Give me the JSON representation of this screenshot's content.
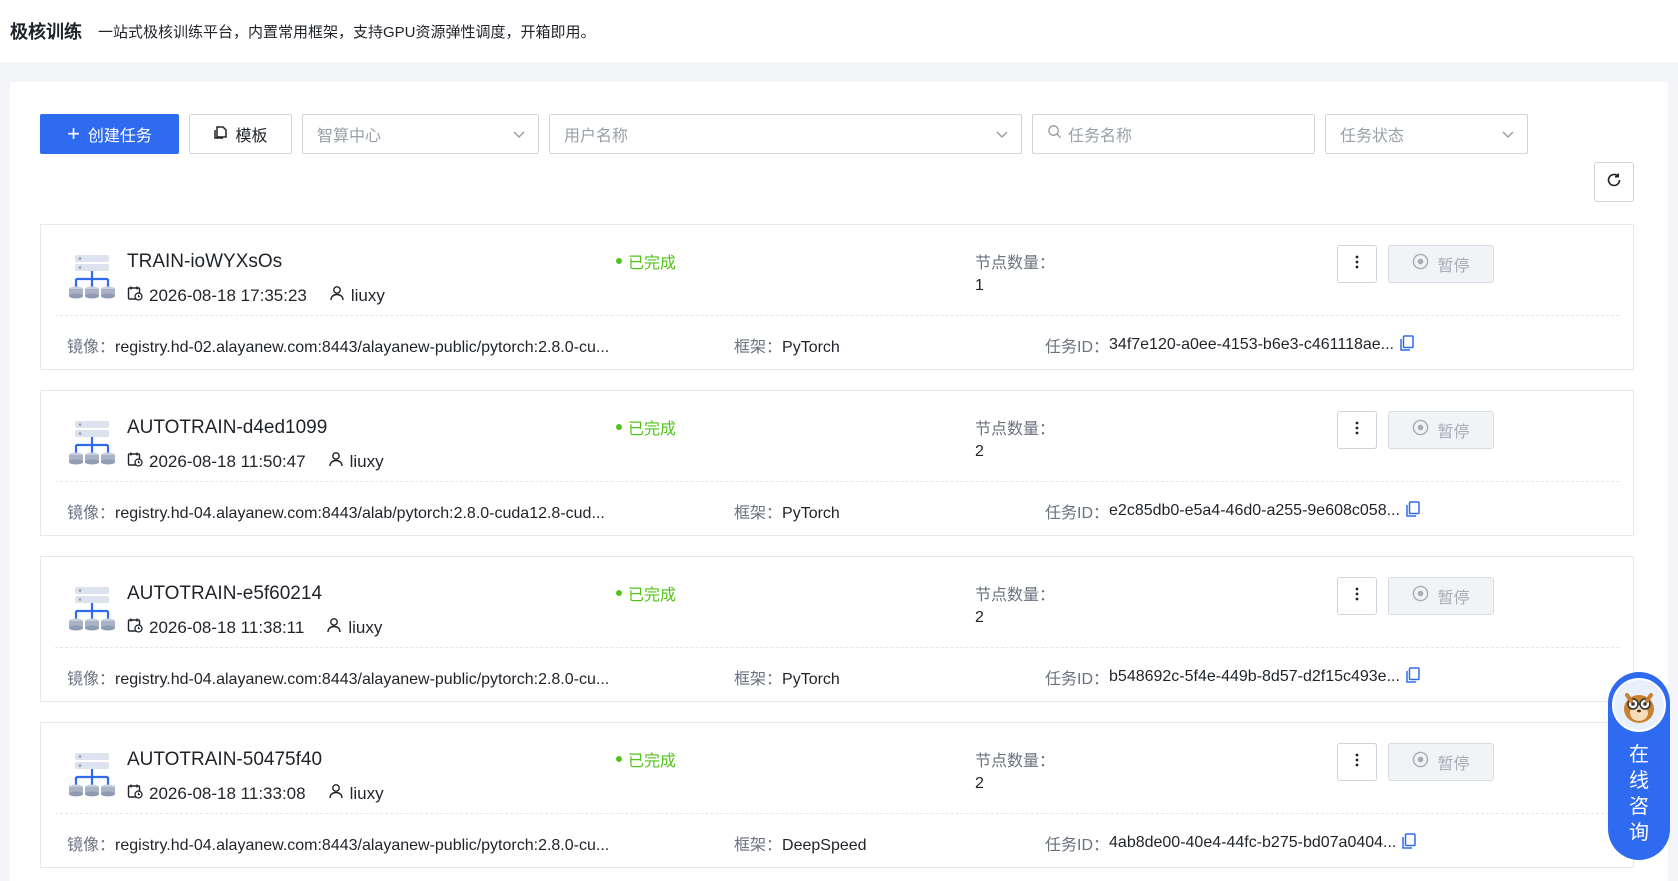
{
  "header": {
    "title": "极核训练",
    "description": "一站式极核训练平台，内置常用框架，支持GPU资源弹性调度，开箱即用。"
  },
  "toolbar": {
    "create_label": "创建任务",
    "template_label": "模板",
    "compute_center_placeholder": "智算中心",
    "username_placeholder": "用户名称",
    "taskname_placeholder": "任务名称",
    "status_placeholder": "任务状态"
  },
  "labels": {
    "nodes": "节点数量：",
    "image": "镜像：",
    "framework": "框架：",
    "task_id": "任务ID：",
    "pause": "暂停"
  },
  "tasks": [
    {
      "name": "TRAIN-ioWYXsOs",
      "time": "2026-08-18 17:35:23",
      "user": "liuxy",
      "status": "已完成",
      "nodes": "1",
      "image": "registry.hd-02.alayanew.com:8443/alayanew-public/pytorch:2.8.0-cu...",
      "framework": "PyTorch",
      "task_id": "34f7e120-a0ee-4153-b6e3-c461118ae..."
    },
    {
      "name": "AUTOTRAIN-d4ed1099",
      "time": "2026-08-18 11:50:47",
      "user": "liuxy",
      "status": "已完成",
      "nodes": "2",
      "image": "registry.hd-04.alayanew.com:8443/alab/pytorch:2.8.0-cuda12.8-cud...",
      "framework": "PyTorch",
      "task_id": "e2c85db0-e5a4-46d0-a255-9e608c058..."
    },
    {
      "name": "AUTOTRAIN-e5f60214",
      "time": "2026-08-18 11:38:11",
      "user": "liuxy",
      "status": "已完成",
      "nodes": "2",
      "image": "registry.hd-04.alayanew.com:8443/alayanew-public/pytorch:2.8.0-cu...",
      "framework": "PyTorch",
      "task_id": "b548692c-5f4e-449b-8d57-d2f15c493e..."
    },
    {
      "name": "AUTOTRAIN-50475f40",
      "time": "2026-08-18 11:33:08",
      "user": "liuxy",
      "status": "已完成",
      "nodes": "2",
      "image": "registry.hd-04.alayanew.com:8443/alayanew-public/pytorch:2.8.0-cu...",
      "framework": "DeepSpeed",
      "task_id": "4ab8de00-40e4-44fc-b275-bd07a0404..."
    }
  ],
  "consult": {
    "label": "在线咨询"
  },
  "colors": {
    "primary": "#2f6bf0",
    "success": "#52c41a",
    "border": "#d0d4db"
  }
}
